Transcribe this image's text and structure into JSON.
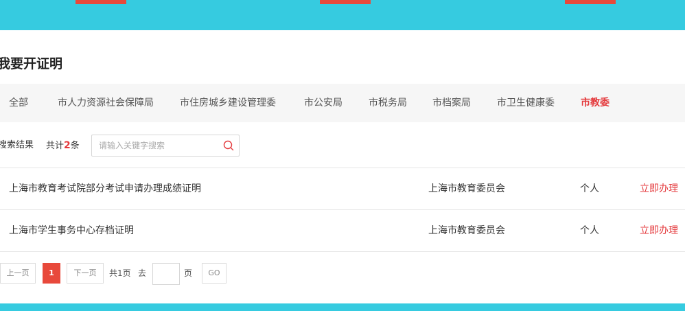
{
  "colors": {
    "band": "#36cbe0",
    "accent": "#e4393c",
    "page_button": "#e8493b"
  },
  "section_title": "我要开证明",
  "tabs": [
    {
      "label": "全部",
      "active": false
    },
    {
      "label": "市人力资源社会保障局",
      "active": false
    },
    {
      "label": "市住房城乡建设管理委",
      "active": false
    },
    {
      "label": "市公安局",
      "active": false
    },
    {
      "label": "市税务局",
      "active": false
    },
    {
      "label": "市档案局",
      "active": false
    },
    {
      "label": "市卫生健康委",
      "active": false
    },
    {
      "label": "市教委",
      "active": true
    }
  ],
  "search": {
    "result_label": "搜索结果",
    "count_prefix": "共计",
    "count": "2",
    "count_suffix": "条",
    "placeholder": "请输入关键字搜索",
    "icon": "search-icon"
  },
  "results": [
    {
      "name": "上海市教育考试院部分考试申请办理成绩证明",
      "department": "上海市教育委员会",
      "target": "个人",
      "action": "立即办理"
    },
    {
      "name": "上海市学生事务中心存档证明",
      "department": "上海市教育委员会",
      "target": "个人",
      "action": "立即办理"
    }
  ],
  "pagination": {
    "prev": "上一页",
    "current": "1",
    "next": "下一页",
    "total": "共1页",
    "goto_label": "去",
    "page_unit": "页",
    "go": "GO"
  }
}
